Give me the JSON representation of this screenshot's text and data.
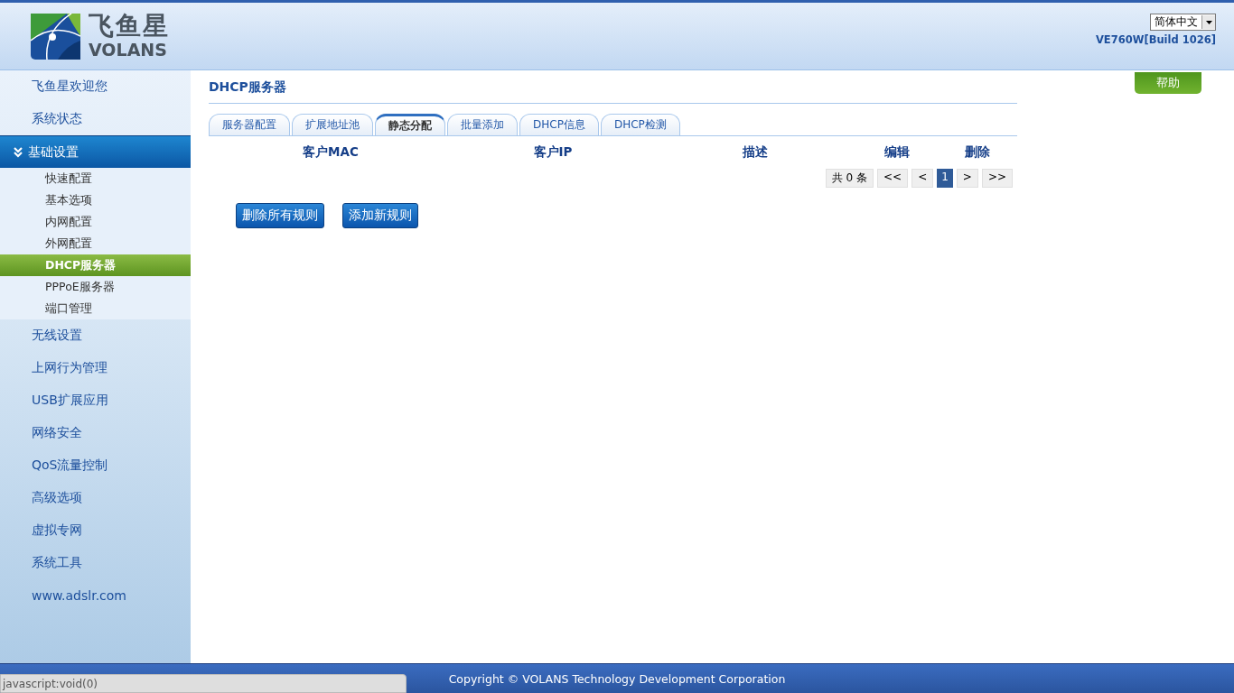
{
  "header": {
    "logo": {
      "name": "飞鱼星",
      "sub": "VOLANS"
    },
    "language": "简体中文",
    "version": "VE760W[Build 1026]"
  },
  "sidebar": {
    "items": [
      {
        "label": "飞鱼星欢迎您",
        "expanded": false
      },
      {
        "label": "系统状态",
        "expanded": false
      },
      {
        "label": "基础设置",
        "expanded": true,
        "children": [
          {
            "label": "快速配置",
            "selected": false
          },
          {
            "label": "基本选项",
            "selected": false
          },
          {
            "label": "内网配置",
            "selected": false
          },
          {
            "label": "外网配置",
            "selected": false
          },
          {
            "label": "DHCP服务器",
            "selected": true
          },
          {
            "label": "PPPoE服务器",
            "selected": false
          },
          {
            "label": "端口管理",
            "selected": false
          }
        ]
      },
      {
        "label": "无线设置",
        "expanded": false
      },
      {
        "label": "上网行为管理",
        "expanded": false
      },
      {
        "label": "USB扩展应用",
        "expanded": false
      },
      {
        "label": "网络安全",
        "expanded": false
      },
      {
        "label": "QoS流量控制",
        "expanded": false
      },
      {
        "label": "高级选项",
        "expanded": false
      },
      {
        "label": "虚拟专网",
        "expanded": false
      },
      {
        "label": "系统工具",
        "expanded": false
      },
      {
        "label": "www.adslr.com",
        "expanded": false
      }
    ]
  },
  "page": {
    "title": "DHCP服务器",
    "help_button": "帮助",
    "tabs": [
      {
        "label": "服务器配置",
        "selected": false
      },
      {
        "label": "扩展地址池",
        "selected": false
      },
      {
        "label": "静态分配",
        "selected": true
      },
      {
        "label": "批量添加",
        "selected": false
      },
      {
        "label": "DHCP信息",
        "selected": false
      },
      {
        "label": "DHCP检测",
        "selected": false
      }
    ],
    "table": {
      "columns": [
        "客户MAC",
        "客户IP",
        "描述",
        "编辑",
        "删除"
      ]
    },
    "pagination": {
      "total": "共 0 条",
      "pages": [
        {
          "label": "<<",
          "selected": false
        },
        {
          "label": "<",
          "selected": false
        },
        {
          "label": "1",
          "selected": true
        },
        {
          "label": ">",
          "selected": false
        },
        {
          "label": ">>",
          "selected": false
        }
      ]
    },
    "buttons": [
      "删除所有规则",
      "添加新规则"
    ]
  },
  "footer": {
    "copyright": "Copyright © VOLANS Technology Development Corporation"
  },
  "status_bar": "javascript:void(0)"
}
